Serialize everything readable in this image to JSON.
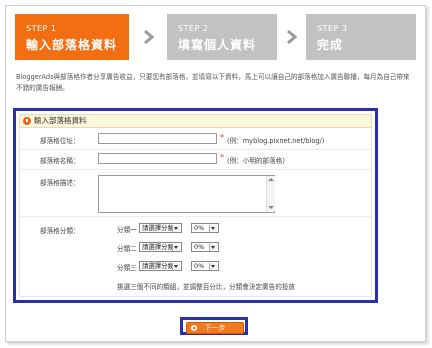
{
  "steps": [
    {
      "num": "STEP 1",
      "title": "輸入部落格資料",
      "active": true
    },
    {
      "num": "STEP 2",
      "title": "填寫個人資料",
      "active": false
    },
    {
      "num": "STEP 3",
      "title": "完成",
      "active": false
    }
  ],
  "intro": "BloggerAds與部落格作者分享廣告收益，只要您有部落格，並填寫以下資料，馬上可以讓自己的部落格加入廣告聯播，每月為自己帶來不錯的廣告報酬。",
  "panel": {
    "title": "輸入部落格資料",
    "url": {
      "label": "部落格位址：",
      "value": "",
      "required": "*",
      "hint": "(例：myblog.pixnet.net/blog/)"
    },
    "name": {
      "label": "部落格名稱：",
      "value": "",
      "required": "*",
      "hint": "(例：小明的部落格)"
    },
    "desc": {
      "label": "部落格描述：",
      "value": ""
    },
    "category": {
      "label": "部落格分類：",
      "rows": [
        {
          "name": "分類一",
          "select": "請選擇分類",
          "percent": "0%"
        },
        {
          "name": "分類二",
          "select": "請選擇分類",
          "percent": "0%"
        },
        {
          "name": "分類三",
          "select": "請選擇分類",
          "percent": "0%"
        }
      ],
      "note": "挑選三個不同的類組，並調整百分比，分類會決定廣告的投放"
    }
  },
  "next_button": "下一步",
  "colors": {
    "accent": "#f26f11",
    "inactive": "#c2c2c2",
    "highlight": "#2b30a8"
  }
}
